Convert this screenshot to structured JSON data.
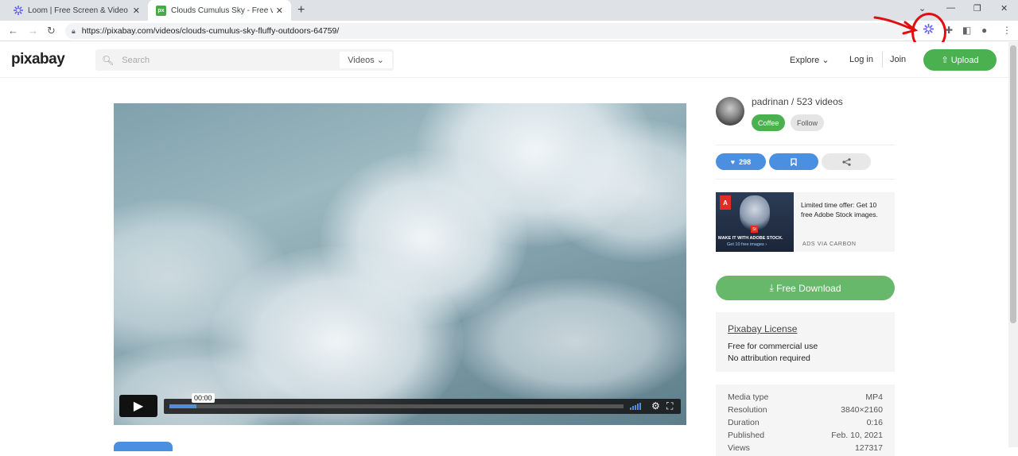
{
  "browser": {
    "tabs": [
      {
        "title": "Loom | Free Screen & Video Re",
        "active": false
      },
      {
        "title": "Clouds Cumulus Sky - Free vide",
        "active": true
      }
    ],
    "url": "https://pixabay.com/videos/clouds-cumulus-sky-fluffy-outdoors-64759/"
  },
  "header": {
    "logo": "pixabay",
    "search_placeholder": "Search",
    "search_type": "Videos",
    "explore": "Explore",
    "login": "Log in",
    "join": "Join",
    "upload": "Upload",
    "brand_color": "#4bb050"
  },
  "player": {
    "time": "00:00",
    "progress": 0.06
  },
  "sidebar": {
    "author": "padrinan / 523 videos",
    "coffee": "Coffee",
    "follow": "Follow",
    "likes": "298",
    "ad": {
      "logo": "A",
      "badge": "St",
      "caption1": "MAKE IT WITH ADOBE STOCK.",
      "caption2": "Get 10 free images ›",
      "text": "Limited time offer: Get 10 free Adobe Stock images.",
      "source": "ADS VIA CARBON"
    },
    "download": "Free Download",
    "license": {
      "title": "Pixabay License",
      "line1": "Free for commercial use",
      "line2": "No attribution required"
    },
    "meta": [
      {
        "label": "Media type",
        "value": "MP4"
      },
      {
        "label": "Resolution",
        "value": "3840×2160"
      },
      {
        "label": "Duration",
        "value": "0:16"
      },
      {
        "label": "Published",
        "value": "Feb. 10, 2021"
      },
      {
        "label": "Views",
        "value": "127317"
      }
    ]
  }
}
